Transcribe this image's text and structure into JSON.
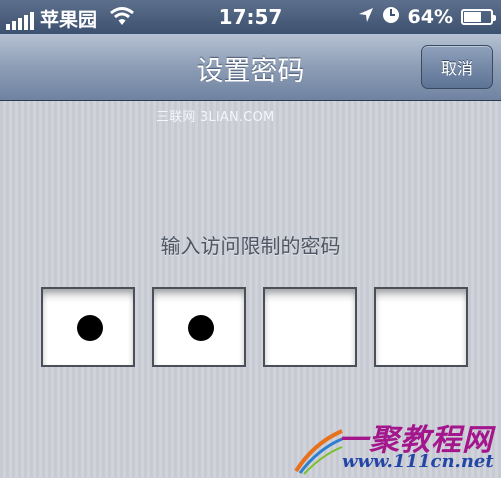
{
  "status_bar": {
    "carrier": "苹果园",
    "time": "17:57",
    "battery_percent": "64%",
    "battery_level": 0.64,
    "icons": [
      "signal-icon",
      "wifi-icon",
      "location-arrow-icon",
      "clock-icon",
      "battery-icon"
    ]
  },
  "nav": {
    "title": "设置密码",
    "cancel_label": "取消"
  },
  "watermark": "三联网 3LIAN.COM",
  "passcode": {
    "prompt": "输入访问限制的密码",
    "digits": [
      {
        "filled": true
      },
      {
        "filled": true
      },
      {
        "filled": false
      },
      {
        "filled": false
      }
    ]
  },
  "site_logo": {
    "name": "一聚教程网",
    "url": "www.111cn.net"
  },
  "colors": {
    "nav_blue": "#8d9db5",
    "status_bar": "#4a5d7c",
    "logo_purple": "#a4168c",
    "logo_blue": "#2346a6"
  }
}
